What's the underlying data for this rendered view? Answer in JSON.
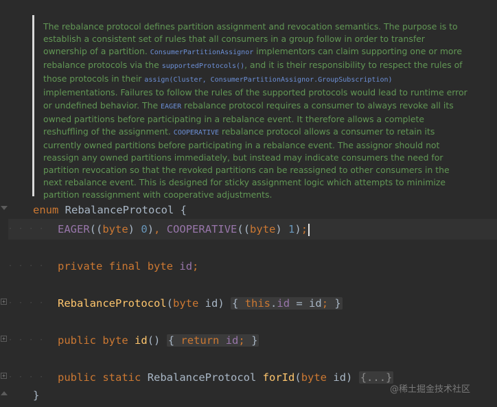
{
  "doc": {
    "t1": "The rebalance protocol defines partition assignment and revocation semantics. The purpose is to establish a consistent set of rules that all consumers in a group follow in order to transfer ownership of a partition. ",
    "c1": "ConsumerPartitionAssignor",
    "t2": " implementors can claim supporting one or more rebalance protocols via the ",
    "c2": "supportedProtocols()",
    "t3": ", and it is their responsibility to respect the rules of those protocols in their ",
    "c3": "assign(Cluster, ConsumerPartitionAssignor.GroupSubscription)",
    "t4": " implementations. Failures to follow the rules of the supported protocols would lead to runtime error or undefined behavior. The ",
    "c4": "EAGER",
    "t5": " rebalance protocol requires a consumer to always revoke all its owned partitions before participating in a rebalance event. It therefore allows a complete reshuffling of the assignment. ",
    "c5": "COOPERATIVE",
    "t6": " rebalance protocol allows a consumer to retain its currently owned partitions before participating in a rebalance event. The assignor should not reassign any owned partitions immediately, but instead may indicate consumers the need for partition revocation so that the revoked partitions can be reassigned to other consumers in the next rebalance event. This is designed for sticky assignment logic which attempts to minimize partition reassignment with cooperative adjustments."
  },
  "code": {
    "enum_kw": "enum",
    "enum_name": "RebalanceProtocol",
    "open_brace": "{",
    "close_brace": "}",
    "eager": "EAGER",
    "cooperative": "COOPERATIVE",
    "byte": "byte",
    "zero": "0",
    "one": "1",
    "private_kw": "private",
    "final_kw": "final",
    "id": "id",
    "ctor_name": "RebalanceProtocol",
    "this_kw": "this",
    "public_kw": "public",
    "static_kw": "static",
    "return_kw": "return",
    "method_id": "id",
    "method_forid": "forId",
    "folded": "{...}"
  },
  "watermark": "@稀土掘金技术社区"
}
